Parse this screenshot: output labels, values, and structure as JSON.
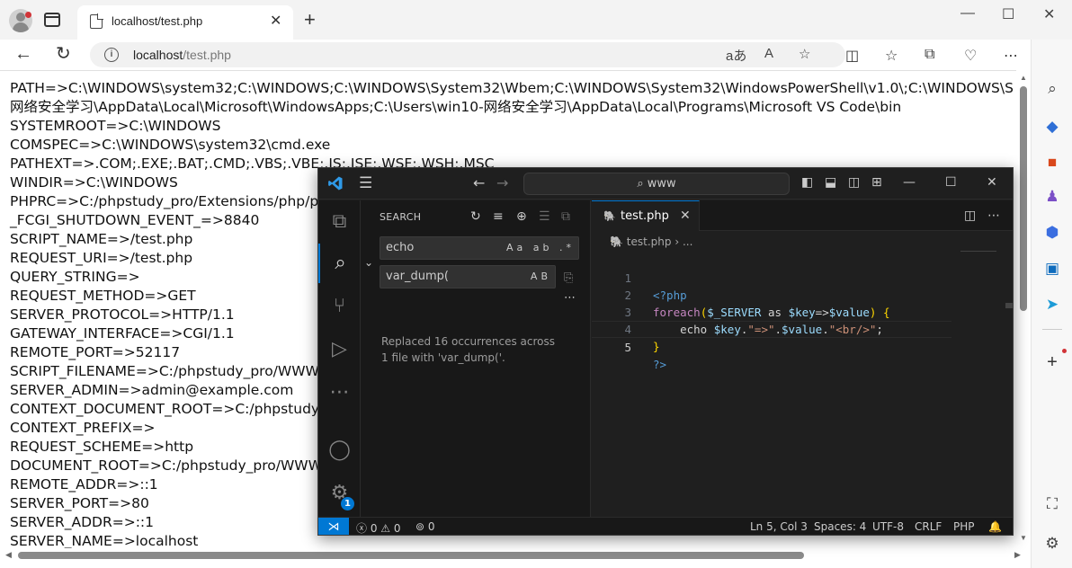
{
  "browser": {
    "tab_title": "localhost/test.php",
    "url_host": "localhost",
    "url_path": "/test.php",
    "tab_close": "✕",
    "new_tab": "+",
    "reading_mode": "aあ",
    "read_aloud": "A",
    "back": "←",
    "refresh": "↻"
  },
  "page": {
    "lines": [
      "PATH=>C:\\WINDOWS\\system32;C:\\WINDOWS;C:\\WINDOWS\\System32\\Wbem;C:\\WINDOWS\\System32\\WindowsPowerShell\\v1.0\\;C:\\WINDOWS\\S",
      "网络安全学习\\AppData\\Local\\Microsoft\\WindowsApps;C:\\Users\\win10-网络安全学习\\AppData\\Local\\Programs\\Microsoft VS Code\\bin",
      "SYSTEMROOT=>C:\\WINDOWS",
      "COMSPEC=>C:\\WINDOWS\\system32\\cmd.exe",
      "PATHEXT=>.COM;.EXE;.BAT;.CMD;.VBS;.VBE;.JS;.JSE;.WSF;.WSH;.MSC",
      "WINDIR=>C:\\WINDOWS",
      "PHPRC=>C:/phpstudy_pro/Extensions/php/p",
      "_FCGI_SHUTDOWN_EVENT_=>8840",
      "SCRIPT_NAME=>/test.php",
      "REQUEST_URI=>/test.php",
      "QUERY_STRING=>",
      "REQUEST_METHOD=>GET",
      "SERVER_PROTOCOL=>HTTP/1.1",
      "GATEWAY_INTERFACE=>CGI/1.1",
      "REMOTE_PORT=>52117",
      "SCRIPT_FILENAME=>C:/phpstudy_pro/WWW",
      "SERVER_ADMIN=>admin@example.com",
      "CONTEXT_DOCUMENT_ROOT=>C:/phpstudy",
      "CONTEXT_PREFIX=>",
      "REQUEST_SCHEME=>http",
      "DOCUMENT_ROOT=>C:/phpstudy_pro/WWW",
      "REMOTE_ADDR=>::1",
      "SERVER_PORT=>80",
      "SERVER_ADDR=>::1",
      "SERVER_NAME=>localhost"
    ]
  },
  "vscode": {
    "title_search": "www",
    "search": {
      "title": "SEARCH",
      "query": "echo",
      "query_opts": "Aa ab .*",
      "replace": "var_dump(",
      "replace_opt": "AB",
      "message": "Replaced 16 occurrences across 1 file with 'var_dump('."
    },
    "tab": {
      "name": "test.php",
      "icon": "php-icon"
    },
    "breadcrumb": {
      "file": "test.php",
      "rest": "..."
    },
    "code": {
      "line_numbers": [
        "1",
        "2",
        "3",
        "4",
        "5"
      ]
    },
    "status": {
      "errors": "0",
      "warnings": "0",
      "ports": "0",
      "position": "Ln 5, Col 3",
      "spaces": "Spaces: 4",
      "encoding": "UTF-8",
      "eol": "CRLF",
      "language": "PHP"
    },
    "settings_badge": "1",
    "colors": {
      "accent": "#0078d4",
      "background": "#1f1f1f"
    }
  }
}
